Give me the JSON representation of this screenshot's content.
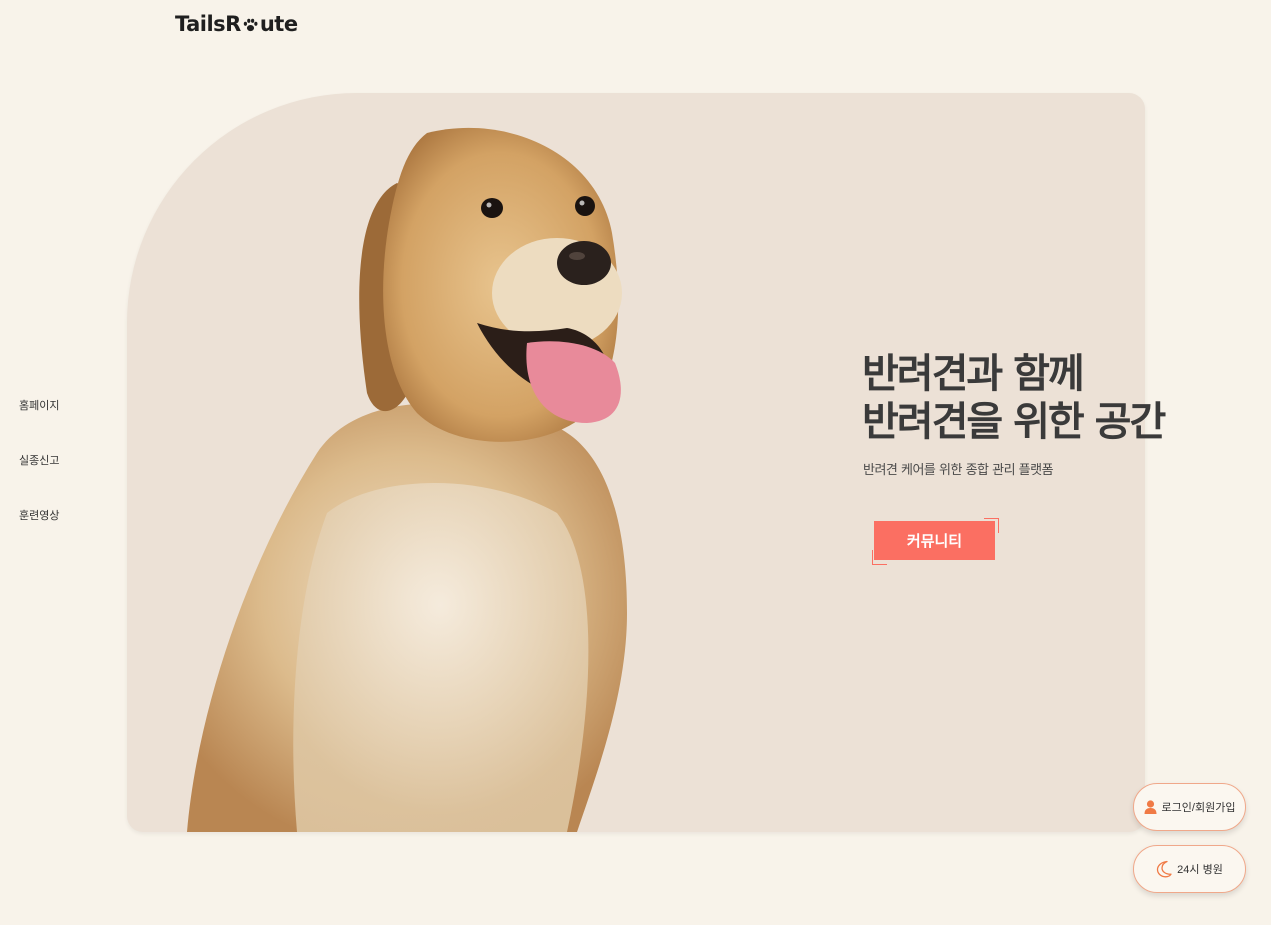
{
  "header": {
    "logo_pre": "TailsR",
    "logo_post": "ute",
    "logo_alt": "TailsRoute"
  },
  "side_nav": {
    "items": [
      {
        "label": "홈페이지"
      },
      {
        "label": "실종신고"
      },
      {
        "label": "훈련영상"
      }
    ]
  },
  "hero": {
    "headline_line1": "반려견과 함께",
    "headline_line2": "반려견을 위한 공간",
    "subline": "반려견 케어를 위한 종합 관리 플랫폼",
    "cta_label": "커뮤니티",
    "image": "golden-retriever-photo"
  },
  "floating": {
    "login_label": "로그인/회원가입",
    "login_icon": "user-icon",
    "hospital_label": "24시 병원",
    "hospital_icon": "moon-icon"
  },
  "colors": {
    "page_bg": "#f8f3ea",
    "card_bg": "#ece1d6",
    "accent": "#fb6f62",
    "icon_orange": "#f07a45"
  }
}
